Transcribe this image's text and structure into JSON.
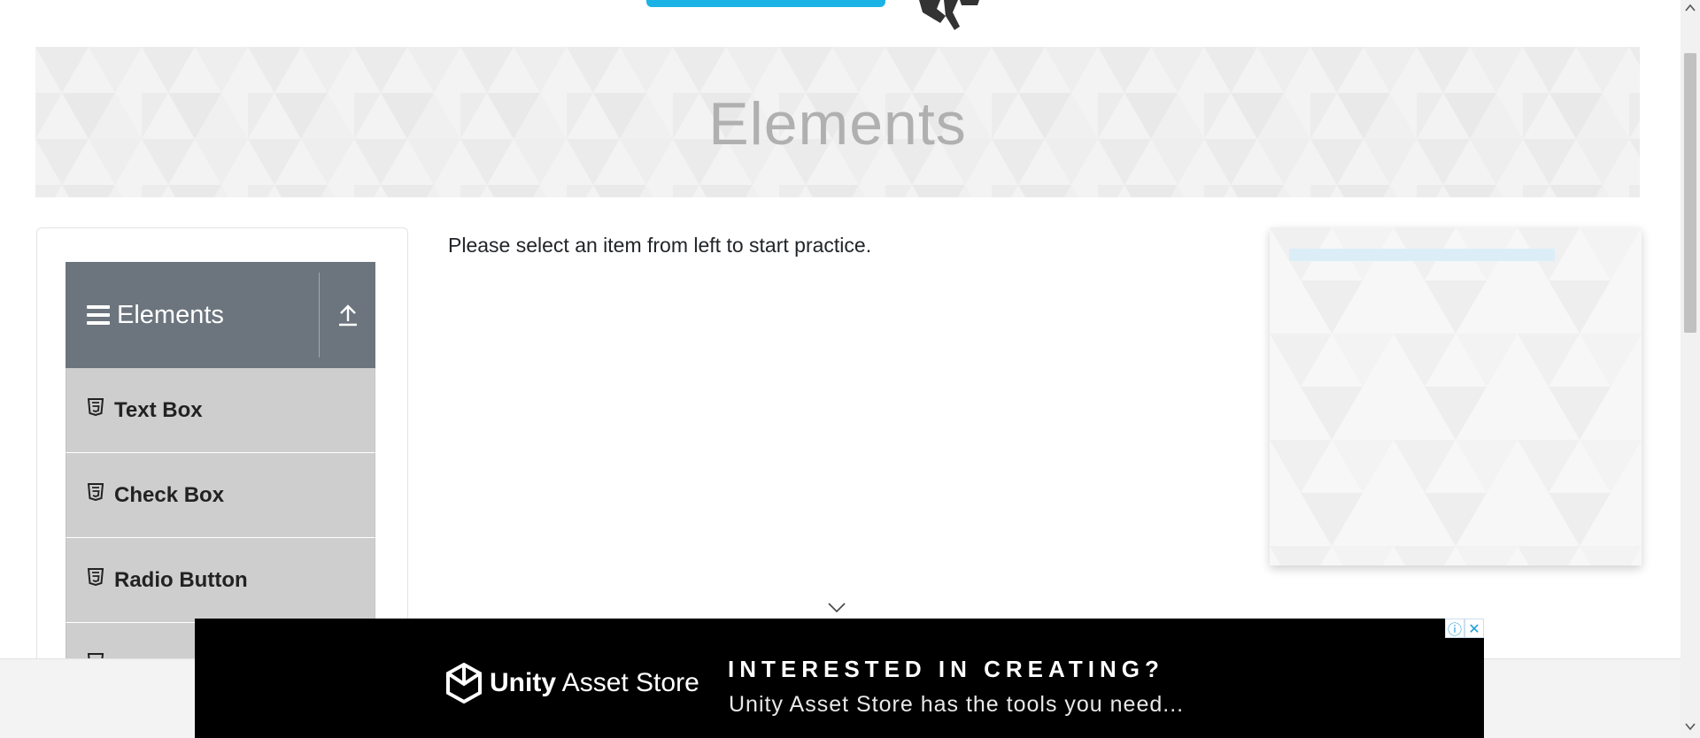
{
  "banner": {
    "title": "Elements"
  },
  "sidebar": {
    "group_title": "Elements",
    "items": [
      {
        "label": "Text Box"
      },
      {
        "label": "Check Box"
      },
      {
        "label": "Radio Button"
      }
    ]
  },
  "main": {
    "message": "Please select an item from left to start practice."
  },
  "ad": {
    "brand_bold": "Unity",
    "brand_rest": " Asset Store",
    "headline": "INTERESTED IN CREATING?",
    "subline": "Unity Asset Store has the tools you need...",
    "info_icon": "ⓘ",
    "close_icon": "✕"
  },
  "colors": {
    "sidebar_header": "#6c757d",
    "menu_item": "#cecece",
    "logo_blue": "#1bb3e6",
    "banner_text": "#b0b0b0"
  },
  "icons": [
    "hamburger-icon",
    "upload-arrow-icon",
    "html5-icon",
    "chevron-down-icon",
    "info-icon",
    "close-icon",
    "unity-cube-icon"
  ]
}
